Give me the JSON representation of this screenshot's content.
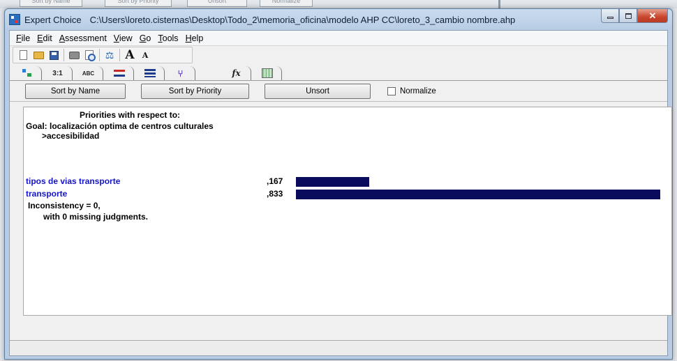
{
  "background": {
    "ghost_buttons": [
      "Sort by Name",
      "Sort by Priority",
      "Unsort",
      "Normalize"
    ]
  },
  "window": {
    "app_name": "Expert Choice",
    "file_path": "C:\\Users\\loreto.cisternas\\Desktop\\Todo_2\\memoria_oficina\\modelo AHP CC\\loreto_3_cambio nombre.ahp",
    "caption_buttons": [
      "minimize",
      "maximize",
      "close"
    ]
  },
  "menu": {
    "items": [
      {
        "key": "F",
        "rest": "ile"
      },
      {
        "key": "E",
        "rest": "dit"
      },
      {
        "key": "A",
        "rest": "ssessment"
      },
      {
        "key": "V",
        "rest": "iew"
      },
      {
        "key": "G",
        "rest": "o"
      },
      {
        "key": "T",
        "rest": "ools"
      },
      {
        "key": "H",
        "rest": "elp"
      }
    ]
  },
  "toolbar": {
    "icons": [
      "new-file-icon",
      "open-folder-icon",
      "save-icon",
      "print-icon",
      "print-preview-icon",
      "scale-icon",
      "font-increase-icon",
      "font-decrease-icon"
    ],
    "font_up": "A",
    "font_down": "A"
  },
  "tabs": {
    "ratio": "3:1",
    "abc": "ABC",
    "fx": "fx"
  },
  "buttons": {
    "sort_by_name": "Sort by Name",
    "sort_by_priority": "Sort by Priority",
    "unsort": "Unsort",
    "normalize": "Normalize",
    "normalize_checked": false
  },
  "report": {
    "heading": "Priorities with respect to:",
    "goal": "Goal: localización optima de centros culturales",
    "node": ">accesibilidad",
    "rows": [
      {
        "label": "tipos de vias transporte",
        "value": ",167",
        "priority": 0.167
      },
      {
        "label": "transporte",
        "value": ",833",
        "priority": 0.833
      }
    ],
    "inconsistency": "Inconsistency = 0,",
    "missing": "with 0  missing judgments."
  },
  "colors": {
    "bar": "#0b0b5c",
    "row_label": "#1414c8"
  }
}
